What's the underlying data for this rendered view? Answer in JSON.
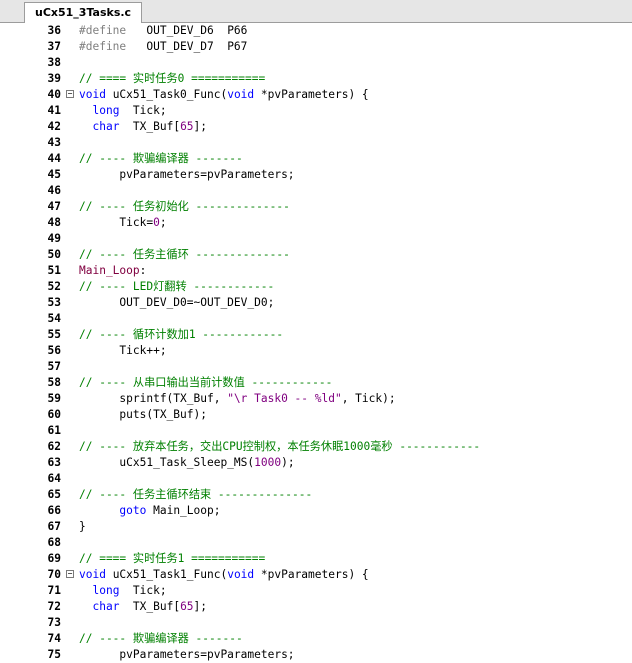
{
  "tab": {
    "title": "uCx51_3Tasks.c"
  },
  "lines": [
    {
      "n": "36",
      "parts": [
        [
          "kw-pre",
          "#define"
        ],
        [
          "txt",
          "   OUT_DEV_D6  P66"
        ]
      ]
    },
    {
      "n": "37",
      "parts": [
        [
          "kw-pre",
          "#define"
        ],
        [
          "txt",
          "   OUT_DEV_D7  P67"
        ]
      ]
    },
    {
      "n": "38",
      "parts": []
    },
    {
      "n": "39",
      "parts": [
        [
          "cm",
          "// ==== 实时任务0 ==========="
        ]
      ]
    },
    {
      "n": "40",
      "fold": true,
      "parts": [
        [
          "kw",
          "void"
        ],
        [
          "txt",
          " uCx51_Task0_Func("
        ],
        [
          "kw",
          "void"
        ],
        [
          "txt",
          " *pvParameters) {"
        ]
      ]
    },
    {
      "n": "41",
      "parts": [
        [
          "txt",
          "  "
        ],
        [
          "kw",
          "long"
        ],
        [
          "txt",
          "  Tick;"
        ]
      ]
    },
    {
      "n": "42",
      "parts": [
        [
          "txt",
          "  "
        ],
        [
          "kw",
          "char"
        ],
        [
          "txt",
          "  TX_Buf["
        ],
        [
          "num",
          "65"
        ],
        [
          "txt",
          "];"
        ]
      ]
    },
    {
      "n": "43",
      "parts": []
    },
    {
      "n": "44",
      "parts": [
        [
          "cm",
          "// ---- 欺骗编译器 -------"
        ]
      ]
    },
    {
      "n": "45",
      "parts": [
        [
          "txt",
          "      pvParameters=pvParameters;"
        ]
      ]
    },
    {
      "n": "46",
      "parts": []
    },
    {
      "n": "47",
      "parts": [
        [
          "cm",
          "// ---- 任务初始化 --------------"
        ]
      ]
    },
    {
      "n": "48",
      "parts": [
        [
          "txt",
          "      Tick="
        ],
        [
          "num",
          "0"
        ],
        [
          "txt",
          ";"
        ]
      ]
    },
    {
      "n": "49",
      "parts": []
    },
    {
      "n": "50",
      "parts": [
        [
          "cm",
          "// ---- 任务主循环 --------------"
        ]
      ]
    },
    {
      "n": "51",
      "parts": [
        [
          "lbl",
          "Main_Loop"
        ],
        [
          "txt",
          ":"
        ]
      ]
    },
    {
      "n": "52",
      "parts": [
        [
          "cm",
          "// ---- LED灯翻转 ------------"
        ]
      ]
    },
    {
      "n": "53",
      "parts": [
        [
          "txt",
          "      OUT_DEV_D0=~OUT_DEV_D0;"
        ]
      ]
    },
    {
      "n": "54",
      "parts": []
    },
    {
      "n": "55",
      "parts": [
        [
          "cm",
          "// ---- 循环计数加1 ------------"
        ]
      ]
    },
    {
      "n": "56",
      "parts": [
        [
          "txt",
          "      Tick++;"
        ]
      ]
    },
    {
      "n": "57",
      "parts": []
    },
    {
      "n": "58",
      "parts": [
        [
          "cm",
          "// ---- 从串口输出当前计数值 ------------"
        ]
      ]
    },
    {
      "n": "59",
      "parts": [
        [
          "txt",
          "      sprintf(TX_Buf, "
        ],
        [
          "str",
          "\"\\r Task0 -- %ld\""
        ],
        [
          "txt",
          ", Tick);"
        ]
      ]
    },
    {
      "n": "60",
      "parts": [
        [
          "txt",
          "      puts(TX_Buf);"
        ]
      ]
    },
    {
      "n": "61",
      "parts": []
    },
    {
      "n": "62",
      "parts": [
        [
          "cm",
          "// ---- 放弃本任务，交出CPU控制权，本任务休眠1000毫秒 ------------"
        ]
      ]
    },
    {
      "n": "63",
      "parts": [
        [
          "txt",
          "      uCx51_Task_Sleep_MS("
        ],
        [
          "num",
          "1000"
        ],
        [
          "txt",
          ");"
        ]
      ]
    },
    {
      "n": "64",
      "parts": []
    },
    {
      "n": "65",
      "parts": [
        [
          "cm",
          "// ---- 任务主循环结束 --------------"
        ]
      ]
    },
    {
      "n": "66",
      "parts": [
        [
          "txt",
          "      "
        ],
        [
          "kw",
          "goto"
        ],
        [
          "txt",
          " Main_Loop;"
        ]
      ]
    },
    {
      "n": "67",
      "parts": [
        [
          "txt",
          "}"
        ]
      ]
    },
    {
      "n": "68",
      "parts": []
    },
    {
      "n": "69",
      "parts": [
        [
          "cm",
          "// ==== 实时任务1 ==========="
        ]
      ]
    },
    {
      "n": "70",
      "fold": true,
      "parts": [
        [
          "kw",
          "void"
        ],
        [
          "txt",
          " uCx51_Task1_Func("
        ],
        [
          "kw",
          "void"
        ],
        [
          "txt",
          " *pvParameters) {"
        ]
      ]
    },
    {
      "n": "71",
      "parts": [
        [
          "txt",
          "  "
        ],
        [
          "kw",
          "long"
        ],
        [
          "txt",
          "  Tick;"
        ]
      ]
    },
    {
      "n": "72",
      "parts": [
        [
          "txt",
          "  "
        ],
        [
          "kw",
          "char"
        ],
        [
          "txt",
          "  TX_Buf["
        ],
        [
          "num",
          "65"
        ],
        [
          "txt",
          "];"
        ]
      ]
    },
    {
      "n": "73",
      "parts": []
    },
    {
      "n": "74",
      "parts": [
        [
          "cm",
          "// ---- 欺骗编译器 -------"
        ]
      ]
    },
    {
      "n": "75",
      "parts": [
        [
          "txt",
          "      pvParameters=pvParameters;"
        ]
      ]
    }
  ],
  "fold_glyph": "−"
}
